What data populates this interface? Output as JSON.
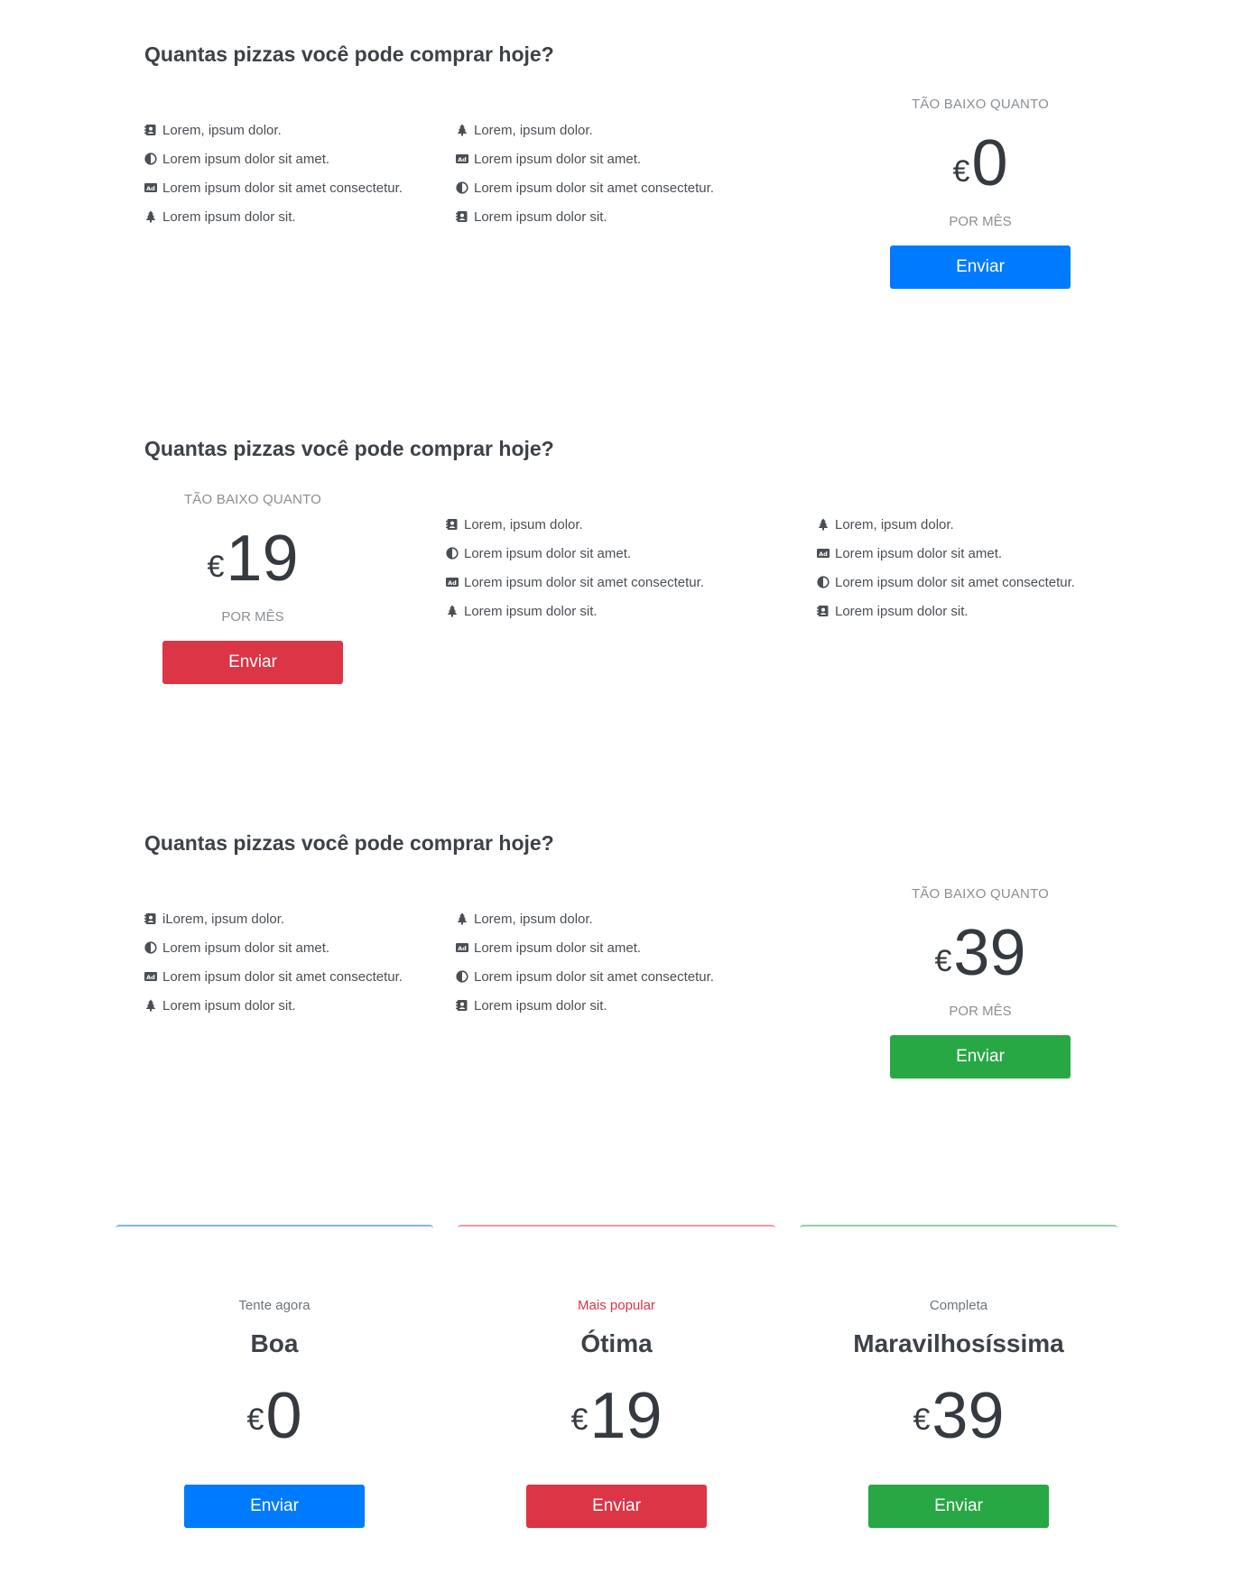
{
  "colors": {
    "blue": "#007bff",
    "red": "#dc3545",
    "green": "#28a745",
    "card_blue": "#7fb9e8",
    "card_red": "#e79aa3",
    "card_green": "#94cf9f"
  },
  "section1": {
    "heading": "Quantas pizzas você pode comprar hoje?",
    "col1": [
      {
        "icon": "contact-book-icon",
        "text": "Lorem, ipsum dolor."
      },
      {
        "icon": "half-circle-icon",
        "text": "Lorem ipsum dolor sit amet."
      },
      {
        "icon": "ad-icon",
        "text": "Lorem ipsum dolor sit amet consectetur."
      },
      {
        "icon": "tree-icon",
        "text": "Lorem ipsum dolor sit."
      }
    ],
    "col2": [
      {
        "icon": "tree-icon",
        "text": "Lorem, ipsum dolor."
      },
      {
        "icon": "ad-icon",
        "text": "Lorem ipsum dolor sit amet."
      },
      {
        "icon": "half-circle-icon",
        "text": "Lorem ipsum dolor sit amet consectetur."
      },
      {
        "icon": "contact-book-icon",
        "text": "Lorem ipsum dolor sit."
      }
    ],
    "eyebrow": "TÃO BAIXO QUANTO",
    "currency": "€",
    "amount": "0",
    "per": "POR MÊS",
    "button": "Enviar"
  },
  "section2": {
    "heading": "Quantas pizzas você pode comprar hoje?",
    "col1": [
      {
        "icon": "contact-book-icon",
        "text": "Lorem, ipsum dolor."
      },
      {
        "icon": "half-circle-icon",
        "text": "Lorem ipsum dolor sit amet."
      },
      {
        "icon": "ad-icon",
        "text": "Lorem ipsum dolor sit amet consectetur."
      },
      {
        "icon": "tree-icon",
        "text": "Lorem ipsum dolor sit."
      }
    ],
    "col2": [
      {
        "icon": "tree-icon",
        "text": "Lorem, ipsum dolor."
      },
      {
        "icon": "ad-icon",
        "text": "Lorem ipsum dolor sit amet."
      },
      {
        "icon": "half-circle-icon",
        "text": "Lorem ipsum dolor sit amet consectetur."
      },
      {
        "icon": "contact-book-icon",
        "text": "Lorem ipsum dolor sit."
      }
    ],
    "eyebrow": "TÃO BAIXO QUANTO",
    "currency": "€",
    "amount": "19",
    "per": "POR MÊS",
    "button": "Enviar"
  },
  "section3": {
    "heading": "Quantas pizzas você pode comprar hoje?",
    "col1": [
      {
        "icon": "contact-book-icon",
        "text": "iLorem, ipsum dolor."
      },
      {
        "icon": "half-circle-icon",
        "text": "Lorem ipsum dolor sit amet."
      },
      {
        "icon": "ad-icon",
        "text": "Lorem ipsum dolor sit amet consectetur."
      },
      {
        "icon": "tree-icon",
        "text": "Lorem ipsum dolor sit."
      }
    ],
    "col2": [
      {
        "icon": "tree-icon",
        "text": "Lorem, ipsum dolor."
      },
      {
        "icon": "ad-icon",
        "text": "Lorem ipsum dolor sit amet."
      },
      {
        "icon": "half-circle-icon",
        "text": "Lorem ipsum dolor sit amet consectetur."
      },
      {
        "icon": "contact-book-icon",
        "text": "Lorem ipsum dolor sit."
      }
    ],
    "eyebrow": "TÃO BAIXO QUANTO",
    "currency": "€",
    "amount": "39",
    "per": "POR MÊS",
    "button": "Enviar"
  },
  "cards": [
    {
      "subtitle": "Tente agora",
      "name": "Boa",
      "currency": "€",
      "amount": "0",
      "button": "Enviar"
    },
    {
      "subtitle": "Mais popular",
      "name": "Ótima",
      "currency": "€",
      "amount": "19",
      "button": "Enviar"
    },
    {
      "subtitle": "Completa",
      "name": "Maravilhosíssima",
      "currency": "€",
      "amount": "39",
      "button": "Enviar"
    }
  ]
}
